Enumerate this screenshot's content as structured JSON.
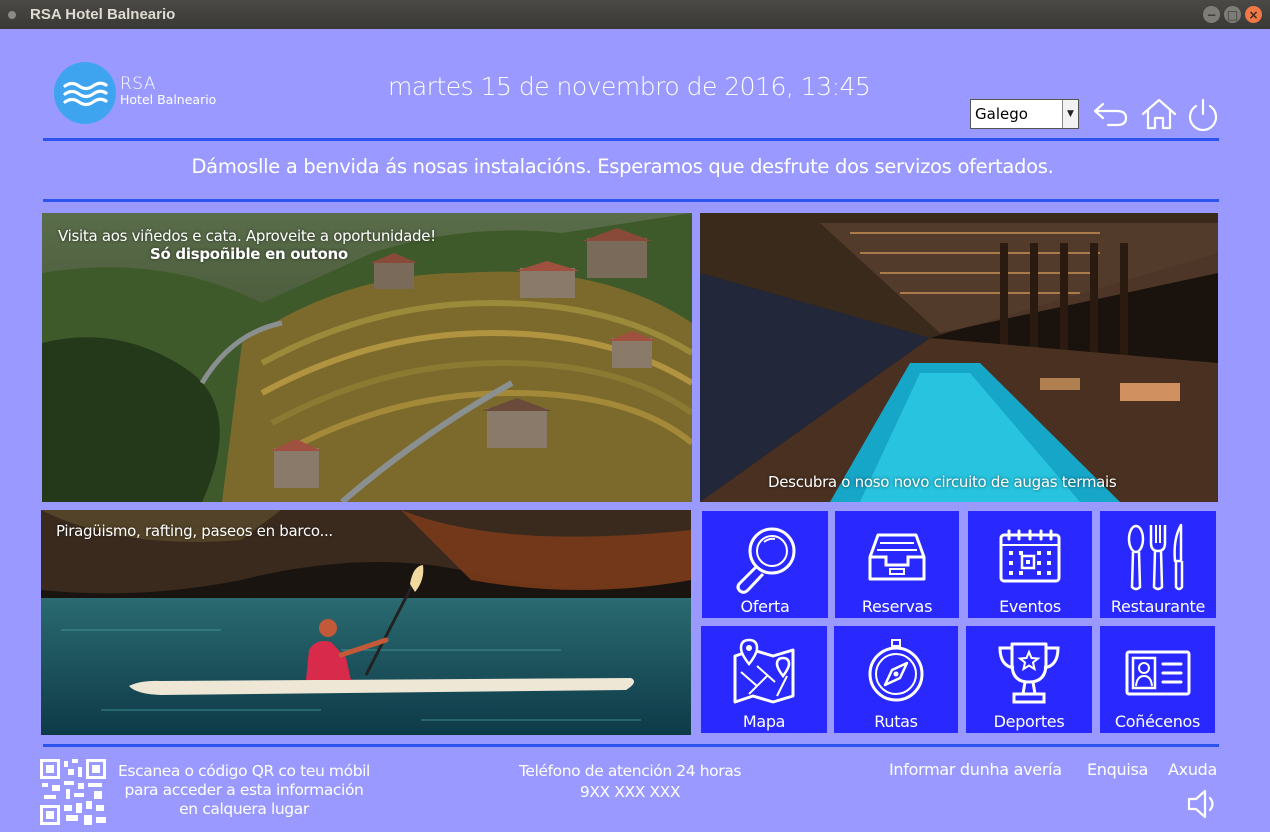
{
  "window": {
    "title": "RSA Hotel Balneario"
  },
  "brand": {
    "name": "RSA",
    "subtitle": "Hotel Balneario"
  },
  "header": {
    "datetime": "martes 15 de novembro de 2016, 13:45",
    "language": {
      "selected": "Galego"
    }
  },
  "welcome": "Dámoslle a benvida ás nosas instalacións. Esperamos que desfrute dos servizos ofertados.",
  "panels": {
    "vineyard": {
      "line1": "Visita aos viñedos e cata. Aproveite a oportunidade!",
      "line2": "Só dispoñible en outono"
    },
    "spa": {
      "caption": "Descubra o noso novo circuito de augas termais"
    },
    "kayak": {
      "caption": "Piragüismo, rafting, paseos en barco..."
    }
  },
  "tiles": [
    {
      "label": "Oferta",
      "icon": "search-icon"
    },
    {
      "label": "Reservas",
      "icon": "inbox-icon"
    },
    {
      "label": "Eventos",
      "icon": "calendar-icon"
    },
    {
      "label": "Restaurante",
      "icon": "cutlery-icon"
    },
    {
      "label": "Mapa",
      "icon": "map-icon"
    },
    {
      "label": "Rutas",
      "icon": "compass-icon"
    },
    {
      "label": "Deportes",
      "icon": "trophy-icon"
    },
    {
      "label": "Coñécenos",
      "icon": "id-card-icon"
    }
  ],
  "footer": {
    "qr_line1": "Escanea o código QR co teu móbil",
    "qr_line2": "para acceder a esta información",
    "qr_line3": "en calquera lugar",
    "phone_label": "Teléfono de atención 24 horas",
    "phone_number": "9XX XXX XXX",
    "links": {
      "report": "Informar dunha avería",
      "survey": "Enquisa",
      "help": "Axuda"
    }
  },
  "colors": {
    "background": "#9999ff",
    "accent": "#2e54f0",
    "tile": "#2929ff",
    "logo": "#3fa4f0"
  }
}
